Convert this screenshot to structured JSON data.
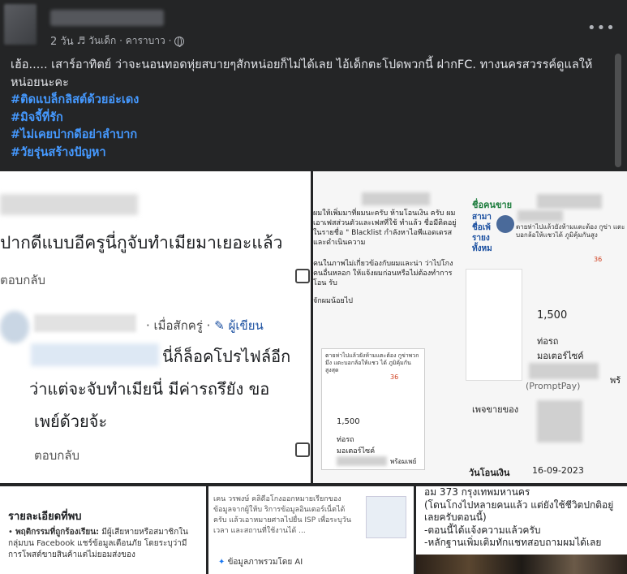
{
  "post": {
    "meta_time": "2 วัน",
    "meta_note": "♬ วันเด็ก · คาราบาว ·",
    "more_label": "•••",
    "caption": "เฮ้อ..... เสาร์อาทิตย์ ว่าจะนอนทอดหุ่ยสบายๆสักหน่อยก็ไม่ได้เลย ไอ้เด็กตะโปดพวกนี้ ฝากFC. ทางนครสวรรค์ดูแลให้หน่อยนะคะ",
    "hashtags": [
      "#ติดแบล็กลิสต์ด้วยอ่ะเดง",
      "#มิจจี้ที่รัก",
      "#ไม่เคยปากดีอย่าลำบาก",
      "#วัยรุ่นสร้างปัญหา"
    ]
  },
  "cell_a": {
    "big_text": "ปากดีแบบอีครูนี่กูจับทำเมียมาเยอะแล้ว",
    "reply1": "ตอบกลับ",
    "meta": "· เมื่อสักครู่ ·",
    "author": "ผู้เขียน",
    "line1": "นี่ก็ล็อคโปรไฟล์อีก",
    "line2": "ว่าแต่จะจับทำเมียนี่ มีค่ารถรึยัง ขอ",
    "line3": "เพย์ด้วยจ้ะ",
    "reply2": "ตอบกลับ"
  },
  "cell_b": {
    "left_p1": "ผมให้เพิ่มมาที่ผมนะครับ ห้ามโอนเงิน ครับ ผมเอาเฟสส่วนตัวและเฟสที่ใช้ ทำแล้ว ชื่อมีติดอยู่ในรายชื่อ \" Blacklist กำลังหาไอพีแอดเดรสและดำเนินความ",
    "left_p2": "คนในภาพไม่เกี่ยวข้องกับผมและน่า ว่าไปโกงคนอื่นหลอก ให้แจ้งผมก่อนหรือไม่ต้องทำการโอน รับ",
    "left_p3": "จักผมน้อยไป",
    "card_text": "ตายห่าไปแล้วยังห้ามแตะต้อง กูข่าพวกมึง แตะบอกล้อให้แชว ได้ ภูมิคุ้มกันสูงสุด",
    "card_count": "36",
    "card_amount": "1,500",
    "card_label": "ท่อรถมอเตอร์ไซค์",
    "card_pay": "พร้อมเพย์",
    "seller_label": "ชื่อคนขาย",
    "right_side": "สามา ชื่อเพ้ รายง ทั้งหม",
    "right_comment": "ตายห่าไปแล้วยังห้ามแตะต้อง กูข่า แตะบอกล้อให้แชวได้ ภูมิคุ้มกันสูง",
    "right_count": "36",
    "right_amount": "1,500",
    "right_label": "ท่อรถมอเตอร์ไซค์",
    "prompt_pay": "(PromptPay)",
    "wallet": "เพจขายของ",
    "date_label": "วันโอนเงิน",
    "date_value": "16-09-2023",
    "edge_text": "พร้"
  },
  "cell_c": {
    "title": "รายละเอียดที่พบ",
    "item_title": "พฤติกรรมที่ถูกร้องเรียน:",
    "item_text": "มีผู้เสียหายหรือสมาชิกในกลุ่มบน Facebook แชร์ข้อมูลเตือนภัย โดยระบุว่ามีการโพสต์ขายสินค้าแต่ไม่ยอมส่งของ"
  },
  "cell_d": {
    "text": "เคน วรพงษ์ คลิดีอโกงออกหมายเรียกของ ข้อมูลจากผู้ให้บ ริการข้อมูลอินเตอร์เน็ตได้ ครับ แล้วเอาหมายศาลไปยื่น ISP เพื่อระบุวัน เวลา และสถานที่ใช้งานได้ ...",
    "ai_label": "ข้อมูลภาพรวมโดย AI"
  },
  "cell_e": {
    "text": "อม 373 กรุงเทพมหานคร\n(โดนโกงไปหลายคนแล้ว แต่ยังใช้ชีวิตปกติอยู่เลยครับตอนนี้)\n-ตอนนี้ได้แจ้งความแล้วครับ\n-หลักฐานเพิ่มเติมทักแชทสอบถามผมได้เลย"
  }
}
